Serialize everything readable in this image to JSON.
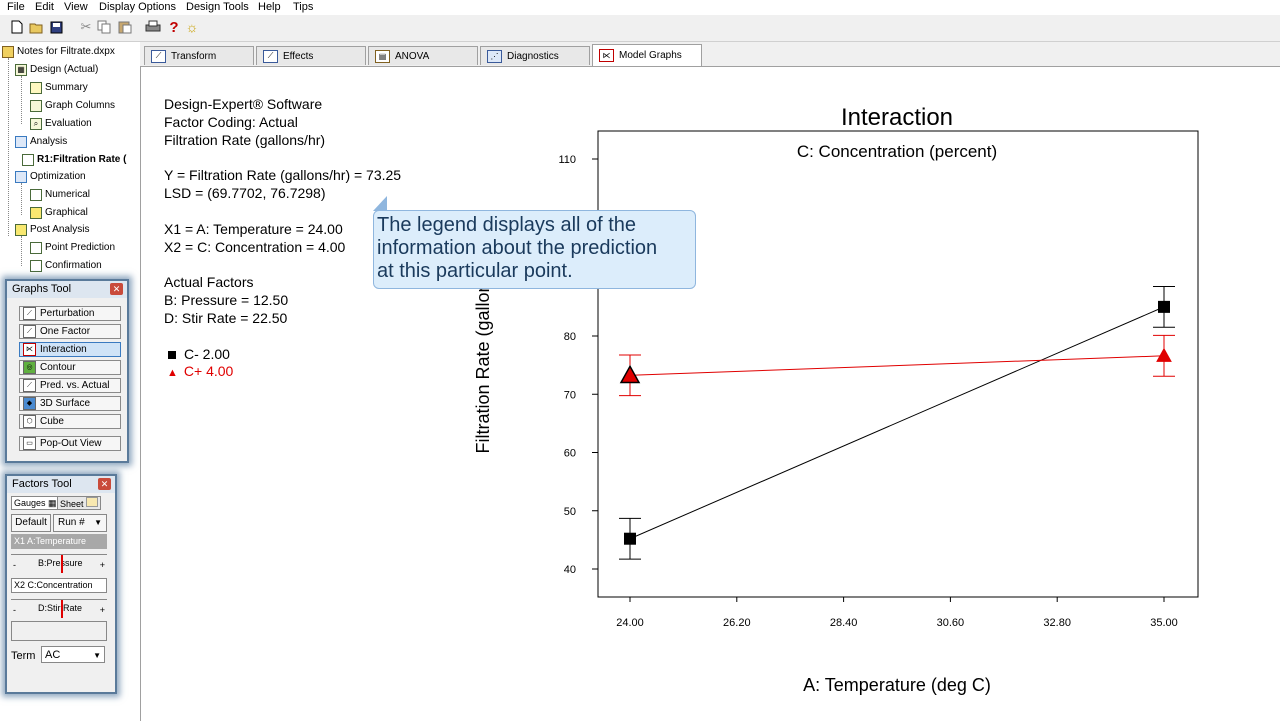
{
  "menu": [
    "File",
    "Edit",
    "View",
    "Display Options",
    "Design Tools",
    "Help",
    "Tips"
  ],
  "toolbar_icons": [
    "new-icon",
    "open-icon",
    "save-icon",
    "cut-icon",
    "copy-icon",
    "paste-icon",
    "print-icon",
    "help-icon",
    "tip-icon"
  ],
  "tree": {
    "root": "Notes for Filtrate.dxpx",
    "design": "Design (Actual)",
    "summary": "Summary",
    "graph_columns": "Graph Columns",
    "evaluation": "Evaluation",
    "analysis": "Analysis",
    "r1": "R1:Filtration Rate (",
    "optimization": "Optimization",
    "numerical": "Numerical",
    "graphical": "Graphical",
    "post_analysis": "Post Analysis",
    "point_prediction": "Point Prediction",
    "confirmation": "Confirmation"
  },
  "tabs": [
    "Transform",
    "Effects",
    "ANOVA",
    "Diagnostics",
    "Model Graphs"
  ],
  "legend": {
    "line1": "Design-Expert® Software",
    "line2": "Factor Coding: Actual",
    "line3": "Filtration Rate (gallons/hr)",
    "y": "Y = Filtration Rate (gallons/hr) = 73.25",
    "lsd": "LSD = (69.7702, 76.7298)",
    "x1": "X1 = A: Temperature = 24.00",
    "x2": "X2 = C: Concentration = 4.00",
    "actual_factors": "Actual Factors",
    "b": "B: Pressure = 12.50",
    "d": "D: Stir Rate = 22.50",
    "c_minus": "C- 2.00",
    "c_plus": "C+ 4.00"
  },
  "callout": {
    "line1": "The legend displays all of the",
    "line2": "information about the prediction",
    "line3": "at this particular point."
  },
  "graphs_tool": {
    "title": "Graphs Tool",
    "buttons": [
      "Perturbation",
      "One Factor",
      "Interaction",
      "Contour",
      "Pred. vs. Actual",
      "3D Surface",
      "Cube",
      "Pop-Out View"
    ],
    "selected": "Interaction"
  },
  "factors_tool": {
    "title": "Factors Tool",
    "tab_gauges": "Gauges",
    "tab_sheet": "Sheet",
    "default_btn": "Default",
    "run_select": "Run #",
    "x1_label": "X1 A:Temperature",
    "b_label": "B:Pressure",
    "x2_label": "X2 C:Concentration",
    "d_label": "D:Stir Rate",
    "minus": "-",
    "plus": "+",
    "term_label": "Term",
    "term_value": "AC"
  },
  "colors": {
    "c_minus": "#000000",
    "c_plus": "#e00000",
    "accent": "#3a7ac0"
  },
  "chart_data": {
    "type": "line",
    "title": "Interaction",
    "subtitle": "C: Concentration (percent)",
    "xlabel": "A: Temperature (deg C)",
    "ylabel": "Filtration Rate (gallons/hr)",
    "xlim": [
      24.0,
      35.0
    ],
    "ylim": [
      35,
      115
    ],
    "x_ticks": [
      "24.00",
      "26.20",
      "28.40",
      "30.60",
      "32.80",
      "35.00"
    ],
    "y_ticks": [
      40,
      50,
      60,
      70,
      80,
      110
    ],
    "x": [
      24.0,
      35.0
    ],
    "series": [
      {
        "name": "C- 2.00",
        "values": [
          45.2,
          85.0
        ],
        "low": [
          41.7,
          81.5
        ],
        "high": [
          48.7,
          88.5
        ],
        "color": "#000000",
        "marker": "square"
      },
      {
        "name": "C+ 4.00",
        "values": [
          73.25,
          76.6
        ],
        "low": [
          69.77,
          73.1
        ],
        "high": [
          76.73,
          80.1
        ],
        "color": "#e00000",
        "marker": "triangle"
      }
    ],
    "grid": false
  }
}
